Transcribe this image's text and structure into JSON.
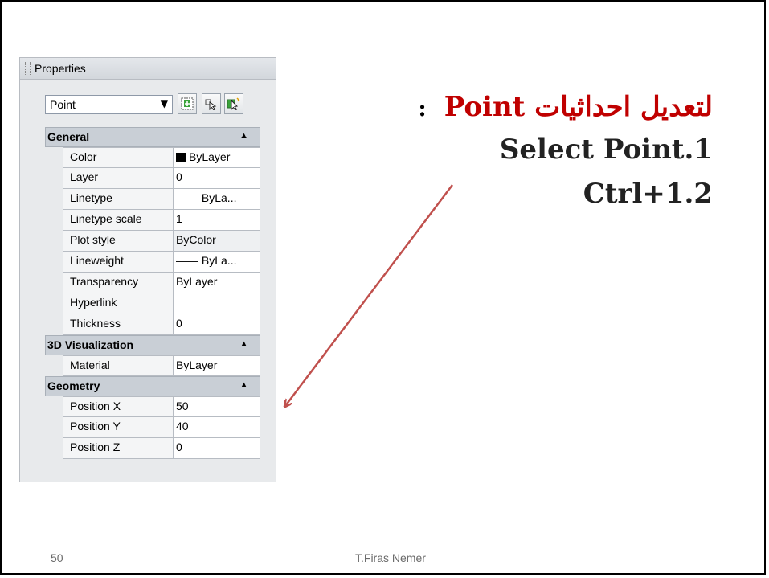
{
  "palette": {
    "title": "Properties",
    "object_selector": "Point",
    "toolbar_icons": [
      "quick-select-icon",
      "select-objects-icon",
      "toggle-pickadd-icon"
    ],
    "categories": [
      {
        "name": "General",
        "rows": [
          {
            "label": "Color",
            "value": "ByLayer",
            "swatch": "#000000"
          },
          {
            "label": "Layer",
            "value": "0"
          },
          {
            "label": "Linetype",
            "value": "—— ByLa..."
          },
          {
            "label": "Linetype scale",
            "value": "1"
          },
          {
            "label": "Plot style",
            "value": "ByColor"
          },
          {
            "label": "Lineweight",
            "value": "—— ByLa..."
          },
          {
            "label": "Transparency",
            "value": "ByLayer"
          },
          {
            "label": "Hyperlink",
            "value": ""
          },
          {
            "label": "Thickness",
            "value": "0"
          }
        ]
      },
      {
        "name": "3D Visualization",
        "rows": [
          {
            "label": "Material",
            "value": "ByLayer"
          }
        ]
      },
      {
        "name": "Geometry",
        "rows": [
          {
            "label": "Position X",
            "value": "50"
          },
          {
            "label": "Position Y",
            "value": "40"
          },
          {
            "label": "Position Z",
            "value": "0"
          }
        ]
      }
    ]
  },
  "slide": {
    "line1_arabic": "لتعديل احداثيات",
    "line1_word": "Point",
    "line1_colon": ":",
    "line2": "Select Point.1",
    "line3": "Ctrl+1.2"
  },
  "footer": {
    "page_number": "50",
    "author": "T.Firas Nemer"
  },
  "colors": {
    "accent_red": "#c00000",
    "arrow": "#c0504d"
  }
}
